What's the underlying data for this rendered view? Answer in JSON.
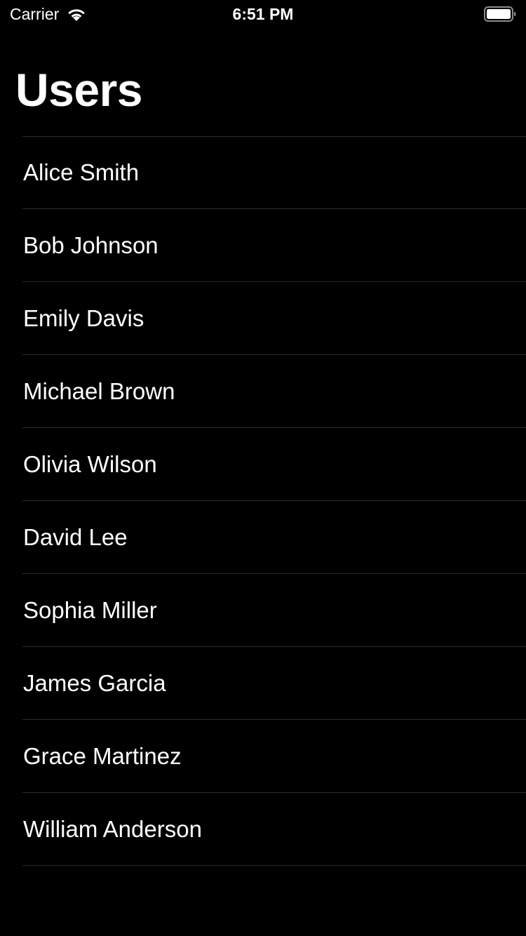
{
  "status_bar": {
    "carrier": "Carrier",
    "time": "6:51 PM",
    "wifi_icon": "wifi-icon",
    "battery_icon": "battery-icon",
    "battery_level": 1.0
  },
  "navigation": {
    "title": "Users"
  },
  "users": [
    {
      "name": "Alice Smith"
    },
    {
      "name": "Bob Johnson"
    },
    {
      "name": "Emily Davis"
    },
    {
      "name": "Michael Brown"
    },
    {
      "name": "Olivia Wilson"
    },
    {
      "name": "David Lee"
    },
    {
      "name": "Sophia Miller"
    },
    {
      "name": "James Garcia"
    },
    {
      "name": "Grace Martinez"
    },
    {
      "name": "William Anderson"
    }
  ],
  "colors": {
    "background": "#000000",
    "text": "#ffffff",
    "separator": "#2b2b2d"
  }
}
